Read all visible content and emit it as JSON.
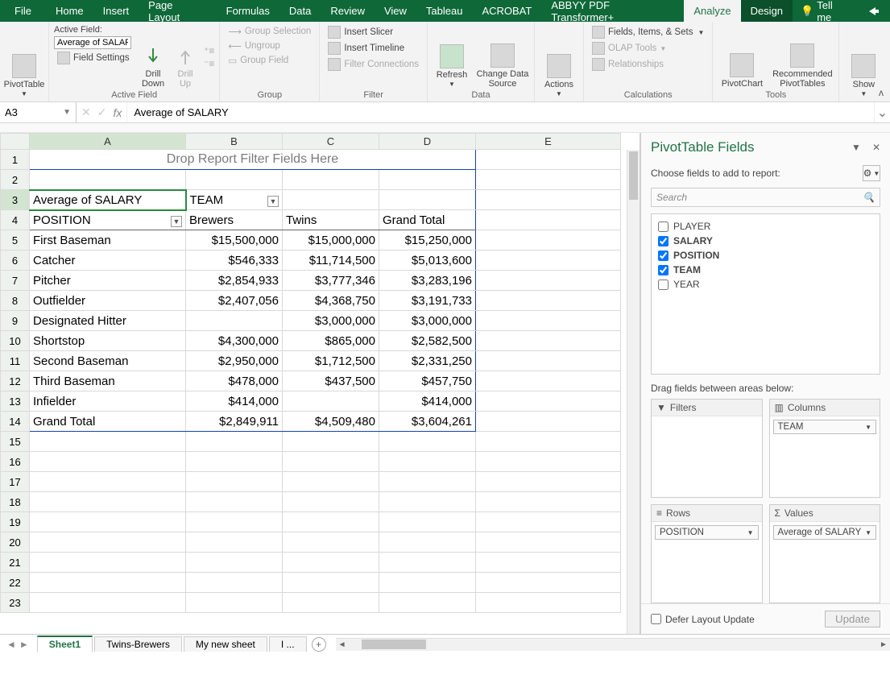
{
  "menu": {
    "file": "File",
    "home": "Home",
    "insert": "Insert",
    "page_layout": "Page Layout",
    "formulas": "Formulas",
    "data": "Data",
    "review": "Review",
    "view": "View",
    "tableau": "Tableau",
    "acrobat": "ACROBAT",
    "abbyy": "ABBYY PDF Transformer+",
    "analyze": "Analyze",
    "design": "Design",
    "tellme": "Tell me"
  },
  "ribbon": {
    "pivottable": "PivotTable",
    "active_field_label": "Active Field:",
    "active_field_value": "Average of SALAR",
    "field_settings": "Field Settings",
    "drill_down": "Drill\nDown",
    "drill_up": "Drill\nUp",
    "group_selection": "Group Selection",
    "ungroup": "Ungroup",
    "group_field": "Group Field",
    "insert_slicer": "Insert Slicer",
    "insert_timeline": "Insert Timeline",
    "filter_connections": "Filter Connections",
    "refresh": "Refresh",
    "change_data": "Change Data\nSource",
    "actions": "Actions",
    "fields_items": "Fields, Items, & Sets",
    "olap": "OLAP Tools",
    "relationships": "Relationships",
    "pivotchart": "PivotChart",
    "recommended": "Recommended\nPivotTables",
    "show": "Show",
    "g_active": "Active Field",
    "g_group": "Group",
    "g_filter": "Filter",
    "g_data": "Data",
    "g_calc": "Calculations",
    "g_tools": "Tools"
  },
  "namebox": "A3",
  "formula": "Average of SALARY",
  "columns": [
    "A",
    "B",
    "C",
    "D",
    "E"
  ],
  "filter_drop": "Drop Report Filter Fields Here",
  "pivot": {
    "measure": "Average of SALARY",
    "col_field": "TEAM",
    "row_field": "POSITION",
    "cols": [
      "Brewers",
      "Twins",
      "Grand Total"
    ],
    "rows": [
      {
        "label": "First Baseman",
        "v": [
          "$15,500,000",
          "$15,000,000",
          "$15,250,000"
        ]
      },
      {
        "label": "Catcher",
        "v": [
          "$546,333",
          "$11,714,500",
          "$5,013,600"
        ]
      },
      {
        "label": "Pitcher",
        "v": [
          "$2,854,933",
          "$3,777,346",
          "$3,283,196"
        ]
      },
      {
        "label": "Outfielder",
        "v": [
          "$2,407,056",
          "$4,368,750",
          "$3,191,733"
        ]
      },
      {
        "label": "Designated Hitter",
        "v": [
          "",
          "$3,000,000",
          "$3,000,000"
        ]
      },
      {
        "label": "Shortstop",
        "v": [
          "$4,300,000",
          "$865,000",
          "$2,582,500"
        ]
      },
      {
        "label": "Second Baseman",
        "v": [
          "$2,950,000",
          "$1,712,500",
          "$2,331,250"
        ]
      },
      {
        "label": "Third Baseman",
        "v": [
          "$478,000",
          "$437,500",
          "$457,750"
        ]
      },
      {
        "label": "Infielder",
        "v": [
          "$414,000",
          "",
          "$414,000"
        ]
      }
    ],
    "grand": {
      "label": "Grand Total",
      "v": [
        "$2,849,911",
        "$4,509,480",
        "$3,604,261"
      ]
    }
  },
  "sheets": {
    "s1": "Sheet1",
    "s2": "Twins-Brewers",
    "s3": "My new sheet",
    "s4": "I ..."
  },
  "pane": {
    "title": "PivotTable Fields",
    "sub": "Choose fields to add to report:",
    "search": "Search",
    "fields": [
      {
        "name": "PLAYER",
        "checked": false
      },
      {
        "name": "SALARY",
        "checked": true
      },
      {
        "name": "POSITION",
        "checked": true
      },
      {
        "name": "TEAM",
        "checked": true
      },
      {
        "name": "YEAR",
        "checked": false
      }
    ],
    "drag": "Drag fields between areas below:",
    "filters": "Filters",
    "columns_h": "Columns",
    "rows_h": "Rows",
    "values_h": "Values",
    "col_item": "TEAM",
    "row_item": "POSITION",
    "val_item": "Average of SALARY",
    "defer": "Defer Layout Update",
    "update": "Update"
  }
}
